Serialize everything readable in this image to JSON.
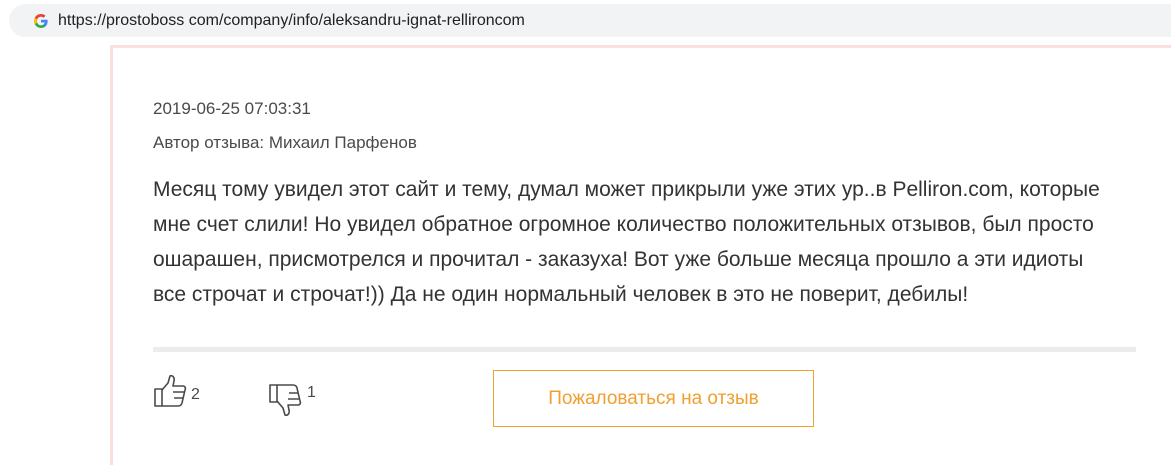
{
  "browser": {
    "url": "https://prostoboss com/company/info/aleksandru-ignat-rellironcom"
  },
  "review": {
    "date": "2019-06-25 07:03:31",
    "author": "Автор отзыва: Михаил Парфенов",
    "text": "Месяц тому увидел этот сайт и тему, думал может прикрыли уже этих ур..в Pelliron.com, которые мне счет слили! Но увидел обратное огромное количество положительных отзывов, был просто ошарашен, присмотрелся и прочитал - заказуха! Вот уже больше месяца прошло а эти идиоты все строчат и строчат!)) Да не один нормальный человек в это не поверит, дебилы!",
    "likes": "2",
    "dislikes": "1",
    "report_label": "Пожаловаться на отзыв"
  },
  "icons": {
    "browser": "google-g-icon",
    "like": "thumbs-up-icon",
    "dislike": "thumbs-down-icon"
  },
  "colors": {
    "accent": "#f0a030",
    "card_border": "#fbdfdf",
    "divider": "#ececec"
  }
}
